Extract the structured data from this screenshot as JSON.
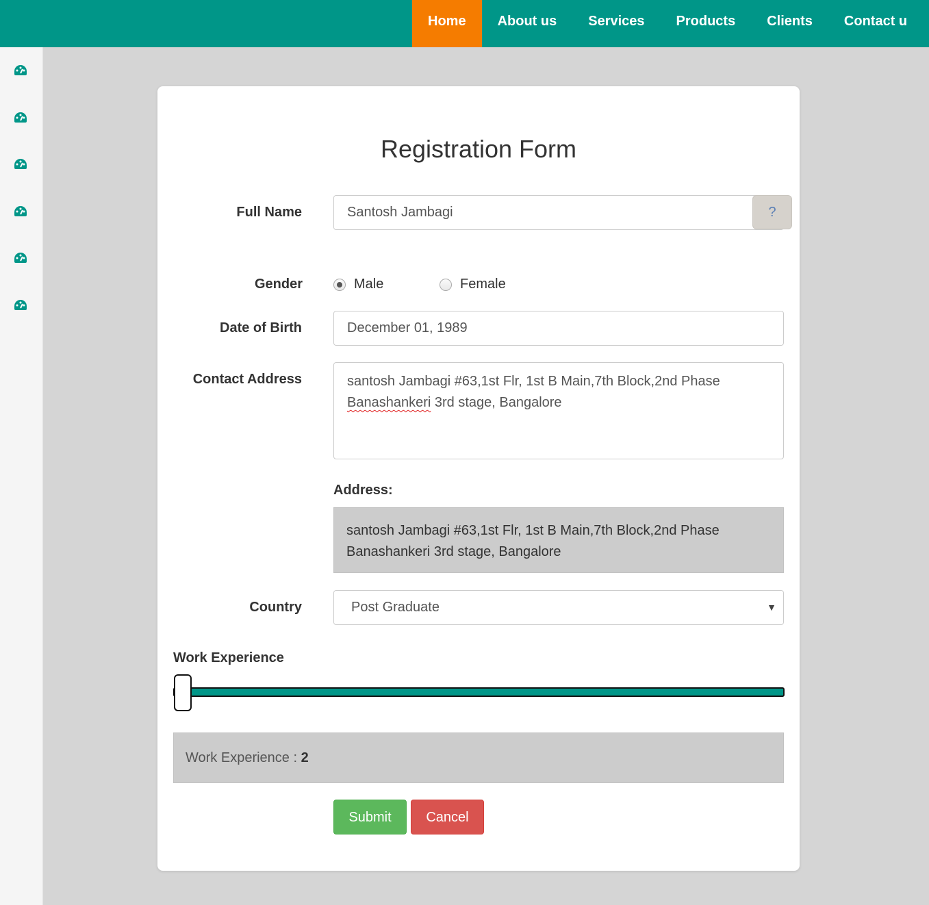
{
  "nav": {
    "items": [
      {
        "label": "Home",
        "active": true
      },
      {
        "label": "About us",
        "active": false
      },
      {
        "label": "Services",
        "active": false
      },
      {
        "label": "Products",
        "active": false
      },
      {
        "label": "Clients",
        "active": false
      },
      {
        "label": "Contact u",
        "active": false
      }
    ]
  },
  "sidebar": {
    "icons": [
      "dashboard-icon",
      "dashboard-icon",
      "dashboard-icon",
      "dashboard-icon",
      "dashboard-icon",
      "dashboard-icon"
    ]
  },
  "form": {
    "title": "Registration Form",
    "full_name": {
      "label": "Full Name",
      "value": "Santosh Jambagi",
      "help": "?"
    },
    "gender": {
      "label": "Gender",
      "options": [
        "Male",
        "Female"
      ],
      "selected": "Male"
    },
    "dob": {
      "label": "Date of Birth",
      "value": "December 01, 1989"
    },
    "contact_address": {
      "label": "Contact Address",
      "line1": "santosh Jambagi #63,1st Flr, 1st B Main,7th Block,2nd Phase",
      "line2_word": "Banashankeri",
      "line2_rest": " 3rd stage, Bangalore"
    },
    "address_preview": {
      "label": "Address:",
      "line1": "santosh Jambagi #63,1st Flr, 1st B Main,7th Block,2nd Phase",
      "line2": "Banashankeri 3rd stage, Bangalore"
    },
    "country": {
      "label": "Country",
      "value": "Post Graduate"
    },
    "work_experience": {
      "label": "Work Experience",
      "display_label": "Work Experience : ",
      "value": "2"
    },
    "submit_label": "Submit",
    "cancel_label": "Cancel"
  },
  "colors": {
    "primary": "#009688",
    "nav_active": "#f57c00",
    "submit": "#5cb85c",
    "cancel": "#d9534f"
  }
}
